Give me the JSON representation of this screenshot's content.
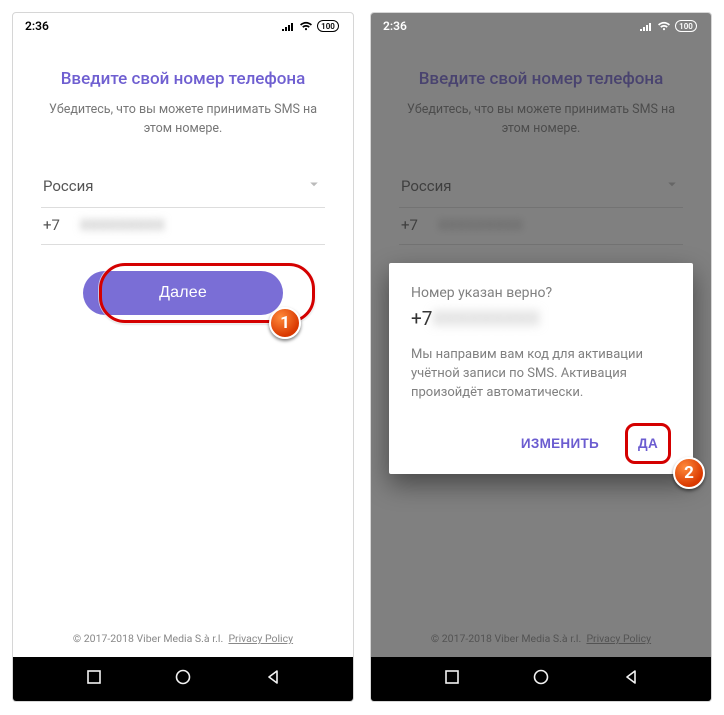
{
  "statusbar": {
    "time": "2:36",
    "battery": "100"
  },
  "screen1": {
    "title": "Введите свой номер телефона",
    "subtitle": "Убедитесь, что вы можете принимать SMS на этом номере.",
    "country": "Россия",
    "prefix": "+7",
    "phone_masked": "XXXXXXXXX",
    "next_label": "Далее"
  },
  "screen2": {
    "title": "Введите свой номер телефона",
    "subtitle": "Убедитесь, что вы можете принимать SMS на этом номере.",
    "country": "Россия",
    "prefix": "+7",
    "dialog": {
      "question": "Номер указан верно?",
      "prefix": "+7",
      "phone_masked": "XXXXXXXXX",
      "info": "Мы направим вам код для активации учётной записи по SMS. Активация произойдёт автоматически.",
      "change_label": "ИЗМЕНИТЬ",
      "yes_label": "ДА"
    }
  },
  "footer": {
    "copyright": "© 2017-2018 Viber Media S.à r.l.",
    "privacy": "Privacy Policy"
  },
  "callouts": {
    "one": "1",
    "two": "2"
  }
}
